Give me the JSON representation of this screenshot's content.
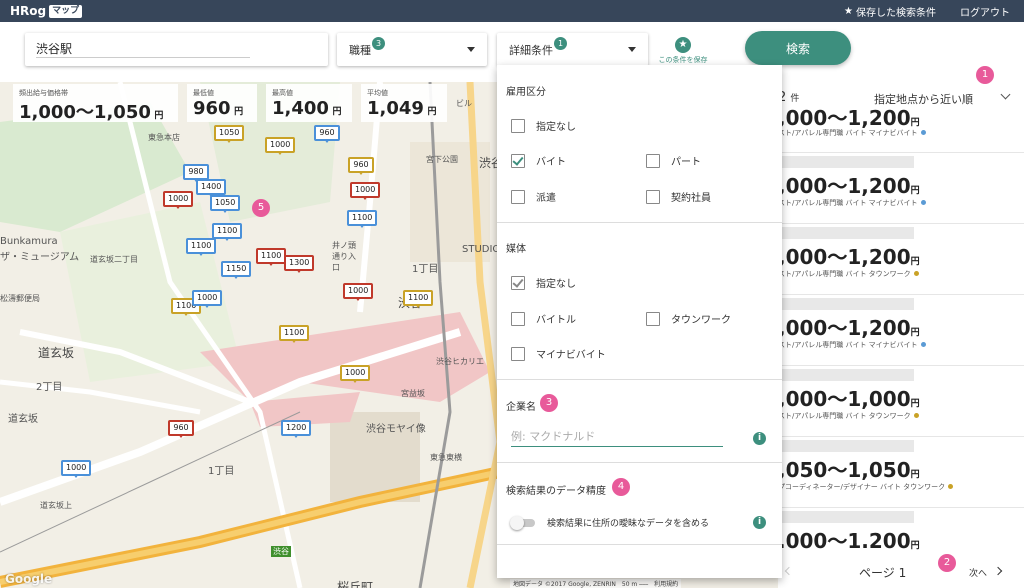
{
  "header": {
    "logo": "HRog",
    "logo_badge": "マップ",
    "saved_link": "保存した検索条件",
    "logout": "ログアウト"
  },
  "search": {
    "location_value": "渋谷駅",
    "job_label": "職種",
    "job_count": "3",
    "detail_label": "詳細条件",
    "detail_count": "1",
    "save_condition": "この条件を保存",
    "search_button": "検索"
  },
  "stats": [
    {
      "label": "頻出給与価格帯",
      "value": "1,000〜1,050",
      "unit": "円"
    },
    {
      "label": "最低値",
      "value": "960",
      "unit": "円"
    },
    {
      "label": "最高値",
      "value": "1,400",
      "unit": "円"
    },
    {
      "label": "平均値",
      "value": "1,049",
      "unit": "円"
    }
  ],
  "panel": {
    "employment_title": "雇用区分",
    "employment_options": [
      {
        "label": "指定なし",
        "checked": false
      },
      {
        "label": "バイト",
        "checked": true
      },
      {
        "label": "パート",
        "checked": false
      },
      {
        "label": "派遣",
        "checked": false
      },
      {
        "label": "契約社員",
        "checked": false
      }
    ],
    "media_title": "媒体",
    "media_options": [
      {
        "label": "指定なし",
        "checked": true
      },
      {
        "label": "バイトル",
        "checked": false
      },
      {
        "label": "タウンワーク",
        "checked": false
      },
      {
        "label": "マイナビバイト",
        "checked": false
      }
    ],
    "company_title": "企業名",
    "company_placeholder": "例: マクドナルド",
    "accuracy_title": "検索結果のデータ精度",
    "accuracy_toggle_label": "検索結果に住所の曖昧なデータを含める",
    "info_icon": "i"
  },
  "results": {
    "count": "2",
    "count_unit": "件",
    "sort_label": "指定地点から近い順",
    "items": [
      {
        "salary": ",000〜1,200",
        "unit": "円",
        "meta": "スト/アパレル専門職 バイト マイナビバイト",
        "dot": "#5b9bd5"
      },
      {
        "salary": ",000〜1,200",
        "unit": "円",
        "meta": "スト/アパレル専門職 バイト マイナビバイト",
        "dot": "#5b9bd5"
      },
      {
        "salary": ",000〜1,200",
        "unit": "円",
        "meta": "スト/アパレル専門職 バイト タウンワーク",
        "dot": "#c9a227"
      },
      {
        "salary": ",000〜1,200",
        "unit": "円",
        "meta": "スト/アパレル専門職 バイト マイナビバイト",
        "dot": "#5b9bd5"
      },
      {
        "salary": ",000〜1,000",
        "unit": "円",
        "meta": "スト/アパレル専門職 バイト タウンワーク",
        "dot": "#c9a227"
      },
      {
        "salary": ",050〜1,050",
        "unit": "円",
        "meta": "プコーディネーター/デザイナー バイト タウンワーク",
        "dot": "#c9a227"
      },
      {
        "salary": ".000〜1.200",
        "unit": "円",
        "meta": "",
        "dot": ""
      }
    ],
    "page_label": "ページ 1",
    "next_label": "次へ"
  },
  "map": {
    "labels": [
      {
        "text": "Bunkamura",
        "cls": ""
      },
      {
        "text": "ザ・ミュージアム",
        "cls": ""
      },
      {
        "text": "道玄坂二丁目",
        "cls": ""
      },
      {
        "text": "松濤郵便局",
        "cls": ""
      },
      {
        "text": "道玄坂",
        "cls": "big"
      },
      {
        "text": "2丁目",
        "cls": ""
      },
      {
        "text": "道玄坂",
        "cls": ""
      },
      {
        "text": "1丁目",
        "cls": ""
      },
      {
        "text": "宮下公園",
        "cls": ""
      },
      {
        "text": "STUDIO",
        "cls": ""
      },
      {
        "text": "渋谷",
        "cls": "big"
      },
      {
        "text": "宮益坂",
        "cls": ""
      },
      {
        "text": "渋谷ヒカリエ",
        "cls": ""
      },
      {
        "text": "渋谷モヤイ像",
        "cls": ""
      },
      {
        "text": "東急東横",
        "cls": ""
      },
      {
        "text": "渋谷",
        "cls": ""
      },
      {
        "text": "桜丘町",
        "cls": "big"
      },
      {
        "text": "ビル",
        "cls": ""
      },
      {
        "text": "東急本店",
        "cls": ""
      },
      {
        "text": "渋谷",
        "cls": "big"
      },
      {
        "text": "1丁目",
        "cls": ""
      },
      {
        "text": "井ノ頭通り入口",
        "cls": ""
      },
      {
        "text": "道玄坂上",
        "cls": ""
      }
    ],
    "markers": [
      {
        "v": "1050",
        "c": "gold"
      },
      {
        "v": "1000",
        "c": "gold"
      },
      {
        "v": "960",
        "c": "blue"
      },
      {
        "v": "980",
        "c": "blue"
      },
      {
        "v": "1400",
        "c": "blue"
      },
      {
        "v": "1000",
        "c": "red"
      },
      {
        "v": "1050",
        "c": "blue"
      },
      {
        "v": "1100",
        "c": "blue"
      },
      {
        "v": "1100",
        "c": "blue"
      },
      {
        "v": "1300",
        "c": "red"
      },
      {
        "v": "1100",
        "c": "red"
      },
      {
        "v": "1150",
        "c": "blue"
      },
      {
        "v": "1100",
        "c": "gold"
      },
      {
        "v": "1000",
        "c": "blue"
      },
      {
        "v": "1100",
        "c": "gold"
      },
      {
        "v": "960",
        "c": "gold"
      },
      {
        "v": "1000",
        "c": "red"
      },
      {
        "v": "1100",
        "c": "blue"
      },
      {
        "v": "1000",
        "c": "red"
      },
      {
        "v": "1100",
        "c": "gold"
      },
      {
        "v": "1000",
        "c": "gold"
      },
      {
        "v": "960",
        "c": "red"
      },
      {
        "v": "1200",
        "c": "blue"
      },
      {
        "v": "1000",
        "c": "blue"
      }
    ],
    "badges": [
      "1",
      "2",
      "3",
      "4",
      "5"
    ],
    "google": "Google",
    "footer": "地図データ ©2017 Google, ZENRIN　50 m ⎯⎯⎯　利用規約"
  },
  "colors": {
    "accent": "#3d8f7e",
    "topbar": "#37465a",
    "badge": "#e85a9a"
  }
}
